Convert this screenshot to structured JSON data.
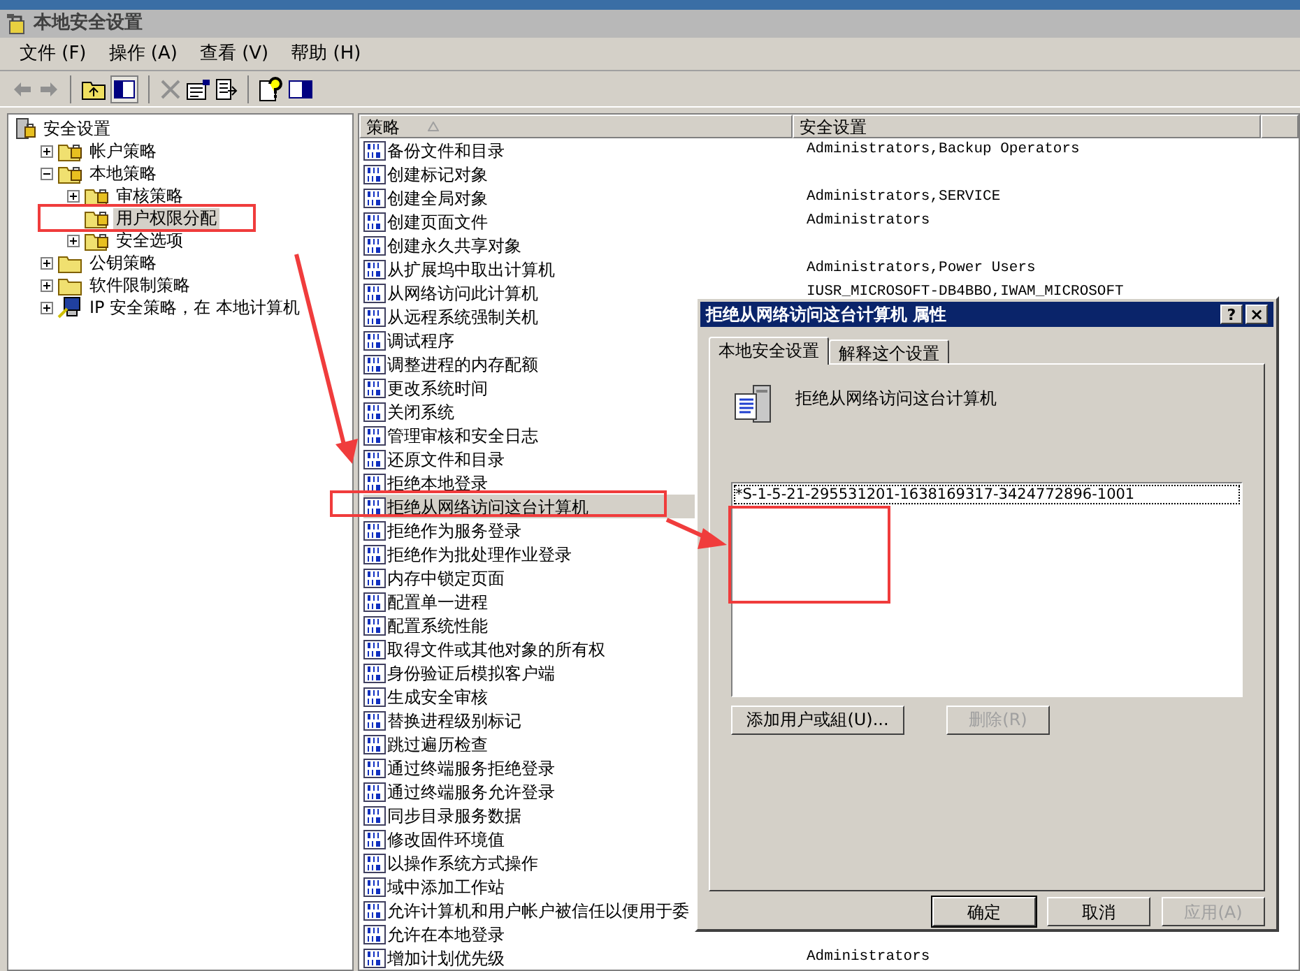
{
  "window": {
    "title": "本地安全设置"
  },
  "menu": [
    "文件 (F)",
    "操作 (A)",
    "查看 (V)",
    "帮助 (H)"
  ],
  "tree": {
    "label": "安全设置",
    "kind": "root",
    "selected": false,
    "children": [
      {
        "label": "帐户策略",
        "kind": "lock-folder",
        "expanded": false,
        "selected": false
      },
      {
        "label": "本地策略",
        "kind": "lock-folder",
        "expanded": true,
        "selected": false,
        "children": [
          {
            "label": "审核策略",
            "kind": "lock-folder",
            "expanded": false,
            "selected": false
          },
          {
            "label": "用户权限分配",
            "kind": "lock-folder",
            "selected": true
          },
          {
            "label": "安全选项",
            "kind": "lock-folder",
            "expanded": false,
            "selected": false
          }
        ]
      },
      {
        "label": "公钥策略",
        "kind": "folder",
        "expanded": false,
        "selected": false
      },
      {
        "label": "软件限制策略",
        "kind": "folder",
        "expanded": false,
        "selected": false
      },
      {
        "label": "IP 安全策略，在 本地计算机",
        "kind": "ip",
        "expanded": false,
        "selected": false
      }
    ]
  },
  "table": {
    "columns": [
      "策略",
      "安全设置"
    ],
    "rows": [
      {
        "policy": "备份文件和目录",
        "setting": "Administrators,Backup Operators",
        "selected": false
      },
      {
        "policy": "创建标记对象",
        "selected": false
      },
      {
        "policy": "创建全局对象",
        "setting": "Administrators,SERVICE",
        "selected": false
      },
      {
        "policy": "创建页面文件",
        "setting": "Administrators",
        "selected": false
      },
      {
        "policy": "创建永久共享对象",
        "selected": false
      },
      {
        "policy": "从扩展坞中取出计算机",
        "setting": "Administrators,Power Users",
        "selected": false
      },
      {
        "policy": "从网络访问此计算机",
        "setting": "IUSR_MICROSOFT-DB4BBO,IWAM_MICROSOFT",
        "selected": false
      },
      {
        "policy": "从远程系统强制关机",
        "selected": false
      },
      {
        "policy": "调试程序",
        "selected": false
      },
      {
        "policy": "调整进程的内存配额",
        "selected": false
      },
      {
        "policy": "更改系统时间",
        "selected": false
      },
      {
        "policy": "关闭系统",
        "selected": false
      },
      {
        "policy": "管理审核和安全日志",
        "selected": false
      },
      {
        "policy": "还原文件和目录",
        "selected": false
      },
      {
        "policy": "拒绝本地登录",
        "selected": false
      },
      {
        "policy": "拒绝从网络访问这台计算机",
        "selected": true
      },
      {
        "policy": "拒绝作为服务登录",
        "selected": false
      },
      {
        "policy": "拒绝作为批处理作业登录",
        "selected": false
      },
      {
        "policy": "内存中锁定页面",
        "selected": false
      },
      {
        "policy": "配置单一进程",
        "selected": false
      },
      {
        "policy": "配置系统性能",
        "selected": false
      },
      {
        "policy": "取得文件或其他对象的所有权",
        "selected": false
      },
      {
        "policy": "身份验证后模拟客户端",
        "selected": false
      },
      {
        "policy": "生成安全审核",
        "selected": false
      },
      {
        "policy": "替换进程级别标记",
        "selected": false
      },
      {
        "policy": "跳过遍历检查",
        "selected": false
      },
      {
        "policy": "通过终端服务拒绝登录",
        "selected": false
      },
      {
        "policy": "通过终端服务允许登录",
        "selected": false
      },
      {
        "policy": "同步目录服务数据",
        "selected": false
      },
      {
        "policy": "修改固件环境值",
        "selected": false
      },
      {
        "policy": "以操作系统方式操作",
        "selected": false
      },
      {
        "policy": "域中添加工作站",
        "selected": false
      },
      {
        "policy": "允许计算机和用户帐户被信任以便用于委",
        "selected": false
      },
      {
        "policy": "允许在本地登录",
        "selected": false
      },
      {
        "policy": "增加计划优先级",
        "setting": "Administrators",
        "selected": false
      }
    ]
  },
  "dialog": {
    "title": "拒绝从网络访问这台计算机 属性",
    "help": "?",
    "close": "×",
    "tabs": [
      {
        "label": "本地安全设置",
        "selected": true
      },
      {
        "label": "解释这个设置",
        "selected": false
      }
    ],
    "heading": "拒绝从网络访问这台计算机",
    "members": [
      "*S-1-5-21-295531201-1638169317-3424772896-1001"
    ],
    "actions": [
      {
        "label": "添加用户或組(U)...",
        "disabled": false
      },
      {
        "label": "删除(R)",
        "disabled": true
      }
    ],
    "buttons": [
      {
        "label": "确定",
        "disabled": false
      },
      {
        "label": "取消",
        "disabled": false
      },
      {
        "label": "应用(A)",
        "disabled": true
      }
    ]
  }
}
